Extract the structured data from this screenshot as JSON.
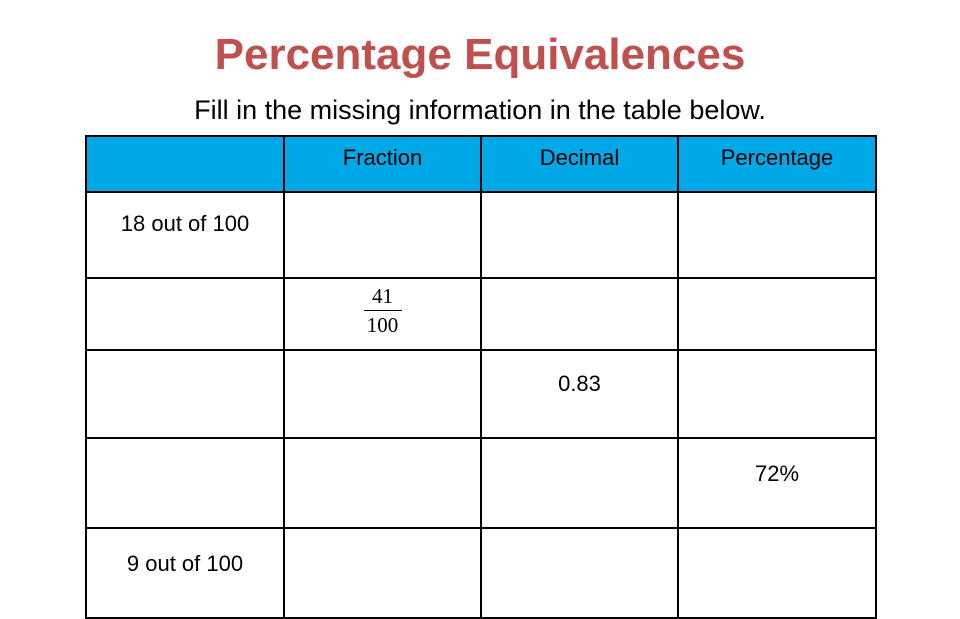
{
  "title": "Percentage Equivalences",
  "subtitle": "Fill in the missing information in the table below.",
  "table": {
    "headers": [
      "",
      "Fraction",
      "Decimal",
      "Percentage"
    ],
    "rows": [
      {
        "description": "18 out of 100",
        "fraction": {
          "numerator": "",
          "denominator": ""
        },
        "decimal": "",
        "percentage": ""
      },
      {
        "description": "",
        "fraction": {
          "numerator": "41",
          "denominator": "100"
        },
        "decimal": "",
        "percentage": ""
      },
      {
        "description": "",
        "fraction": {
          "numerator": "",
          "denominator": ""
        },
        "decimal": "0.83",
        "percentage": ""
      },
      {
        "description": "",
        "fraction": {
          "numerator": "",
          "denominator": ""
        },
        "decimal": "",
        "percentage": "72%"
      },
      {
        "description": "9 out of 100",
        "fraction": {
          "numerator": "",
          "denominator": ""
        },
        "decimal": "",
        "percentage": ""
      }
    ]
  },
  "colors": {
    "title": "#c0504d",
    "header_bg": "#00a8e8"
  }
}
